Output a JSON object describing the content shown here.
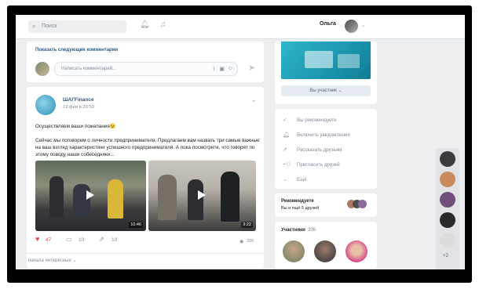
{
  "header": {
    "search_placeholder": "Поиск",
    "user_name": "Ольга",
    "icons": [
      "search-icon",
      "bell-icon",
      "music-icon",
      "chevron-down-icon"
    ]
  },
  "comments": {
    "show_next": "Показать следующие комментарии",
    "write_placeholder": "Написать комментарий..."
  },
  "post": {
    "author": "ШАГFinance",
    "date": "12 фев в 20:50",
    "title": "Осуществляем ваши пожелания😉",
    "body": "Сейчас мы поговорим о личности предпринимателя. Предлагаем вам назвать три самые важные на ваш взгляд характеристики успешного предпринимателя. А пока посмотрите, что говорят по этому поводу наши собеседники...",
    "videos": [
      {
        "duration": "10:46"
      },
      {
        "duration": "3:22"
      }
    ],
    "likes": "47",
    "comments": "10",
    "shares": "10",
    "views": "336"
  },
  "footer": {
    "sort_label": "начала интересные"
  },
  "group": {
    "member_button": "Вы участник"
  },
  "actions_menu": {
    "items": [
      {
        "label": "Вы рекомендуете",
        "icon": "check-icon"
      },
      {
        "label": "Включить уведомления",
        "icon": "bell-icon"
      },
      {
        "label": "Рассказать друзьям",
        "icon": "share-icon"
      },
      {
        "label": "Пригласить друзей",
        "icon": "add-user-icon"
      },
      {
        "label": "Ещё",
        "icon": "chevron-down-icon"
      }
    ]
  },
  "recommend": {
    "line1": "Рекомендуете",
    "line2": "Вы и ещё 5 друзей"
  },
  "members": {
    "title": "Участники",
    "count": "336"
  },
  "side_strip": {
    "more_count": "+2"
  }
}
